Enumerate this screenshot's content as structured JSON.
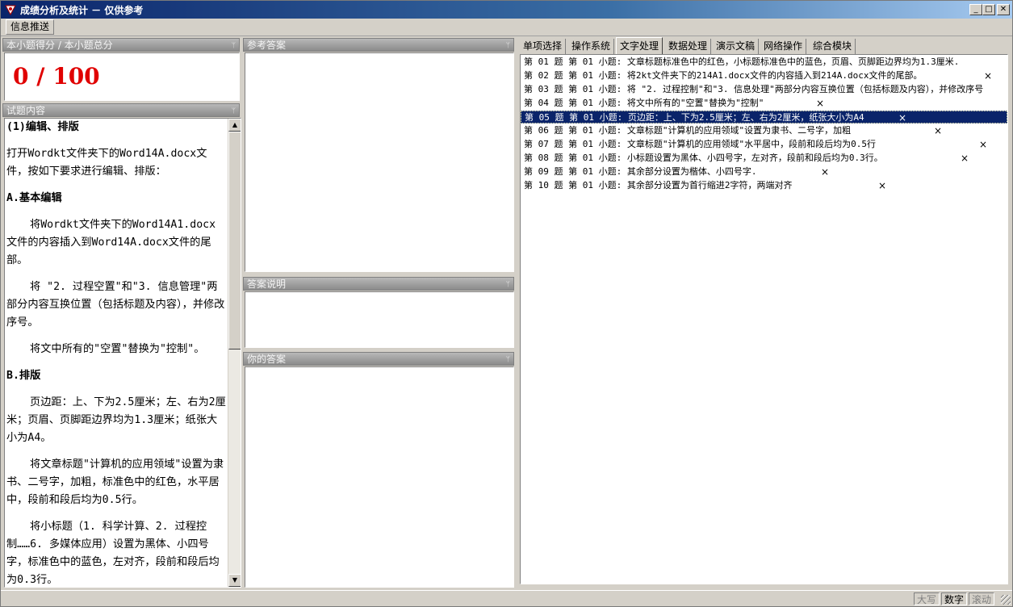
{
  "window": {
    "title": "成绩分析及统计 － 仅供参考",
    "min_glyph": "_",
    "max_glyph": "□",
    "close_glyph": "✕"
  },
  "toolbar": {
    "info_push": "信息推送"
  },
  "score_pane": {
    "header": "本小题得分 / 本小题总分",
    "value": "0 / 100"
  },
  "content_pane": {
    "header": "试题内容",
    "paragraphs": [
      "(1)编辑、排版",
      "打开Wordkt文件夹下的Word14A.docx文件，按如下要求进行编辑、排版：",
      "A.基本编辑",
      "将Wordkt文件夹下的Word14A1.docx文件的内容插入到Word14A.docx文件的尾部。",
      "将 \"2. 过程空置\"和\"3. 信息管理\"两部分内容互换位置（包括标题及内容），并修改序号。",
      "将文中所有的\"空置\"替换为\"控制\"。",
      "B.排版",
      "页边距：上、下为2.5厘米；左、右为2厘米；页眉、页脚距边界均为1.3厘米；纸张大小为A4。",
      "将文章标题\"计算机的应用领域\"设置为隶书、二号字，加粗，标准色中的红色，水平居中，段前和段后均为0.5行。",
      "将小标题（1. 科学计算、2. 过程控制……6. 多媒体应用）设置为黑体、小四号字，标准色中的蓝色，左对齐，段前和段后均为0.3行。"
    ]
  },
  "reference_pane": {
    "header": "参考答案"
  },
  "explain_pane": {
    "header": "答案说明"
  },
  "your_answer_pane": {
    "header": "你的答案"
  },
  "tabs": [
    "单项选择",
    "操作系统",
    "文字处理",
    "数据处理",
    "演示文稿",
    "网络操作",
    "综合模块"
  ],
  "active_tab": 2,
  "questions": [
    {
      "text": "第 01 题 第 01 小题: 文章标题标准色中的红色，小标题标准色中的蓝色，页眉、页脚距边界均为1.3厘米.",
      "mark": ""
    },
    {
      "text": "第 02 题 第 01 小题: 将2kt文件夹下的214A1.docx文件的内容插入到214A.docx文件的尾部。",
      "mark": "×"
    },
    {
      "text": "第 03 题 第 01 小题: 将 \"2. 过程控制\"和\"3. 信息处理\"两部分内容互换位置（包括标题及内容），并修改序号",
      "mark": ""
    },
    {
      "text": "第 04 题 第 01 小题: 将文中所有的\"空置\"替换为\"控制\"",
      "mark": "×"
    },
    {
      "text": "第 05 题 第 01 小题: 页边距：上、下为2.5厘米；左、右为2厘米，纸张大小为A4",
      "mark": "×"
    },
    {
      "text": "第 06 题 第 01 小题: 文章标题\"计算机的应用领域\"设置为隶书、二号字，加粗",
      "mark": "×"
    },
    {
      "text": "第 07 题 第 01 小题: 文章标题\"计算机的应用领域\"水平居中，段前和段后均为0.5行",
      "mark": "×"
    },
    {
      "text": "第 08 题 第 01 小题: 小标题设置为黑体、小四号字，左对齐，段前和段后均为0.3行。",
      "mark": "×"
    },
    {
      "text": "第 09 题 第 01 小题: 其余部分设置为楷体、小四号字.",
      "mark": "×"
    },
    {
      "text": "第 10 题 第 01 小题: 其余部分设置为首行缩进2字符，两端对齐",
      "mark": "×"
    }
  ],
  "selected_question": 4,
  "status": {
    "caps": "大写",
    "num": "数字",
    "scroll": "滚动"
  },
  "colors": {
    "title_bar": "#0a246a",
    "score": "#e00000",
    "selection": "#0a246a"
  }
}
